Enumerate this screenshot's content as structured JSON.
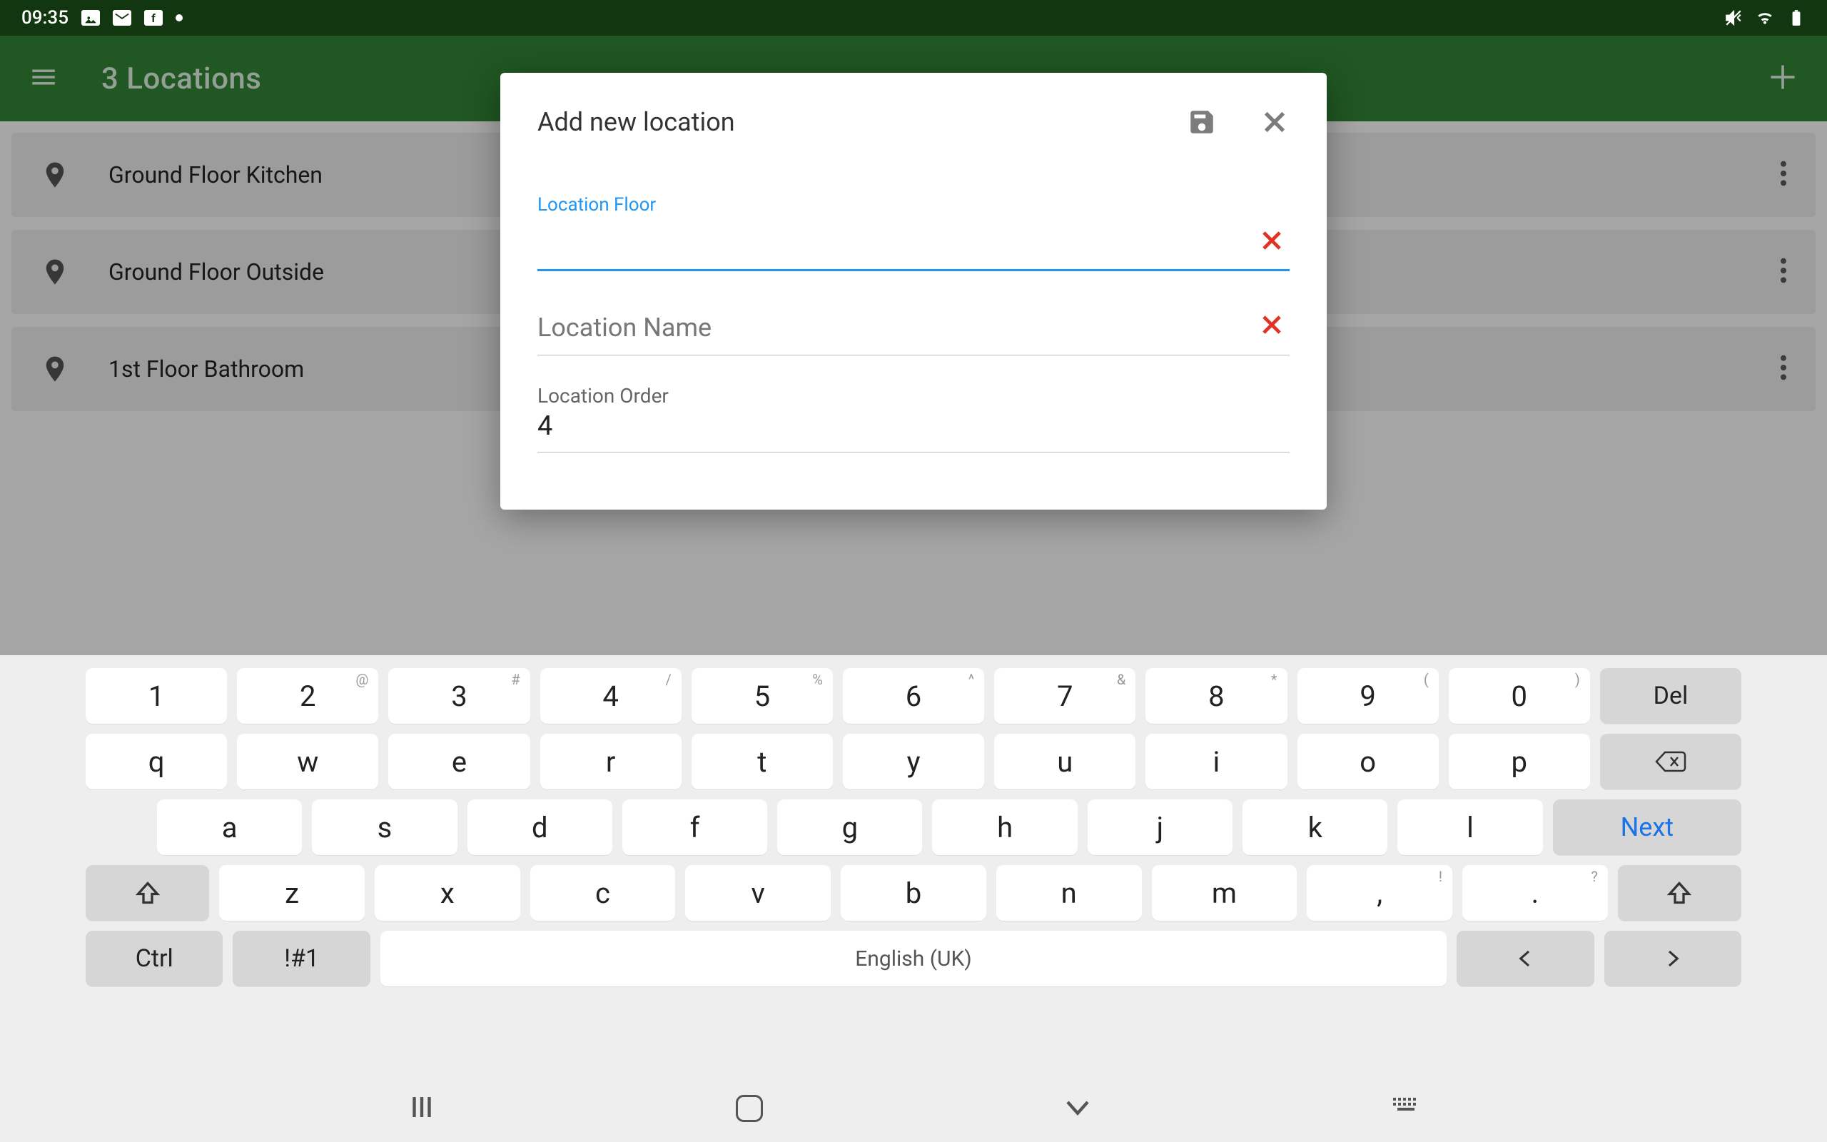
{
  "status": {
    "time": "09:35",
    "icons": [
      "image-icon",
      "mail-icon",
      "facebook-icon"
    ]
  },
  "appbar": {
    "title": "3 Locations"
  },
  "locations": [
    {
      "label": "Ground Floor Kitchen"
    },
    {
      "label": "Ground Floor Outside"
    },
    {
      "label": "1st Floor Bathroom"
    }
  ],
  "dialog": {
    "title": "Add new location",
    "floor_label": "Location Floor",
    "floor_value": "",
    "name_placeholder": "Location Name",
    "name_value": "",
    "order_label": "Location Order",
    "order_value": "4"
  },
  "keyboard": {
    "row1": [
      {
        "main": "1",
        "sup": ""
      },
      {
        "main": "2",
        "sup": "@"
      },
      {
        "main": "3",
        "sup": "#"
      },
      {
        "main": "4",
        "sup": "/"
      },
      {
        "main": "5",
        "sup": "%"
      },
      {
        "main": "6",
        "sup": "^"
      },
      {
        "main": "7",
        "sup": "&"
      },
      {
        "main": "8",
        "sup": "*"
      },
      {
        "main": "9",
        "sup": "("
      },
      {
        "main": "0",
        "sup": ")"
      }
    ],
    "row1_last": "Del",
    "row2": [
      "q",
      "w",
      "e",
      "r",
      "t",
      "y",
      "u",
      "i",
      "o",
      "p"
    ],
    "row3": [
      "a",
      "s",
      "d",
      "f",
      "g",
      "h",
      "j",
      "k",
      "l"
    ],
    "row3_action": "Next",
    "row4": [
      "z",
      "x",
      "c",
      "v",
      "b",
      "n",
      "m"
    ],
    "row4_punc": [
      ",",
      "."
    ],
    "row4_punc_sup": [
      "!",
      "?"
    ],
    "row5_ctrl": "Ctrl",
    "row5_sym": "!#1",
    "row5_space": "English (UK)"
  }
}
